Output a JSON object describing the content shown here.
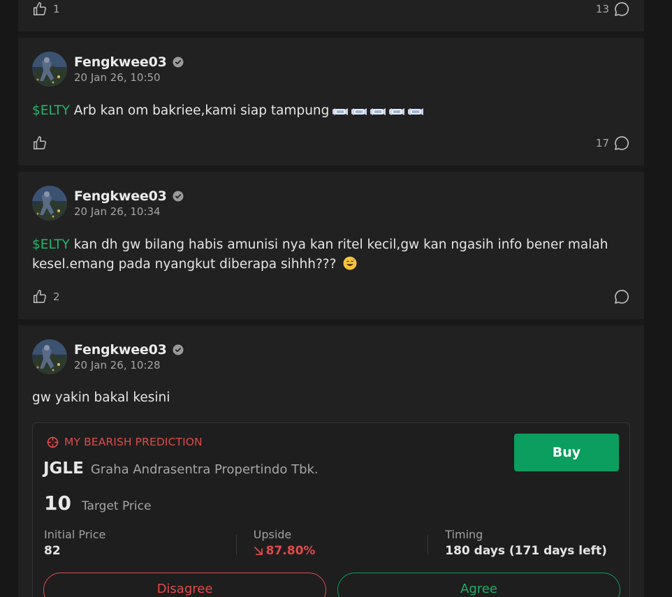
{
  "posts": [
    {
      "likes": "1",
      "comments": "13"
    },
    {
      "username": "Fengkwee03",
      "time": "20 Jan 26, 10:50",
      "ticker": "$ELTY",
      "text": " Arb kan om bakriee,kami siap tampung",
      "likes": "",
      "comments": "17"
    },
    {
      "username": "Fengkwee03",
      "time": "20 Jan 26, 10:34",
      "ticker": "$ELTY",
      "text": " kan dh gw bilang habis amunisi nya kan ritel kecil,gw kan ngasih info bener malah kesel.emang pada nyangkut diberapa sihhh??? ",
      "likes": "2",
      "comments": ""
    },
    {
      "username": "Fengkwee03",
      "time": "20 Jan 26, 10:28",
      "text": "gw yakin bakal kesini"
    }
  ],
  "prediction": {
    "tag": "MY BEARISH PREDICTION",
    "buy_label": "Buy",
    "stock_code": "JGLE",
    "stock_name": "Graha Andrasentra Propertindo Tbk.",
    "target_value": "10",
    "target_label": "Target Price",
    "initial_label": "Initial Price",
    "initial_value": "82",
    "upside_label": "Upside",
    "upside_value": "87.80%",
    "timing_label": "Timing",
    "timing_value": "180 days (171 days left)",
    "disagree_label": "Disagree",
    "agree_label": "Agree"
  },
  "colors": {
    "accent_green": "#0b9e5f",
    "ticker_green": "#25b36b",
    "bearish_red": "#e24a4a"
  },
  "icons": [
    "thumbs-up-icon",
    "comment-icon",
    "verified-icon",
    "target-icon",
    "arrow-down-right-icon",
    "money-wings-emoji",
    "sweat-smile-emoji"
  ]
}
